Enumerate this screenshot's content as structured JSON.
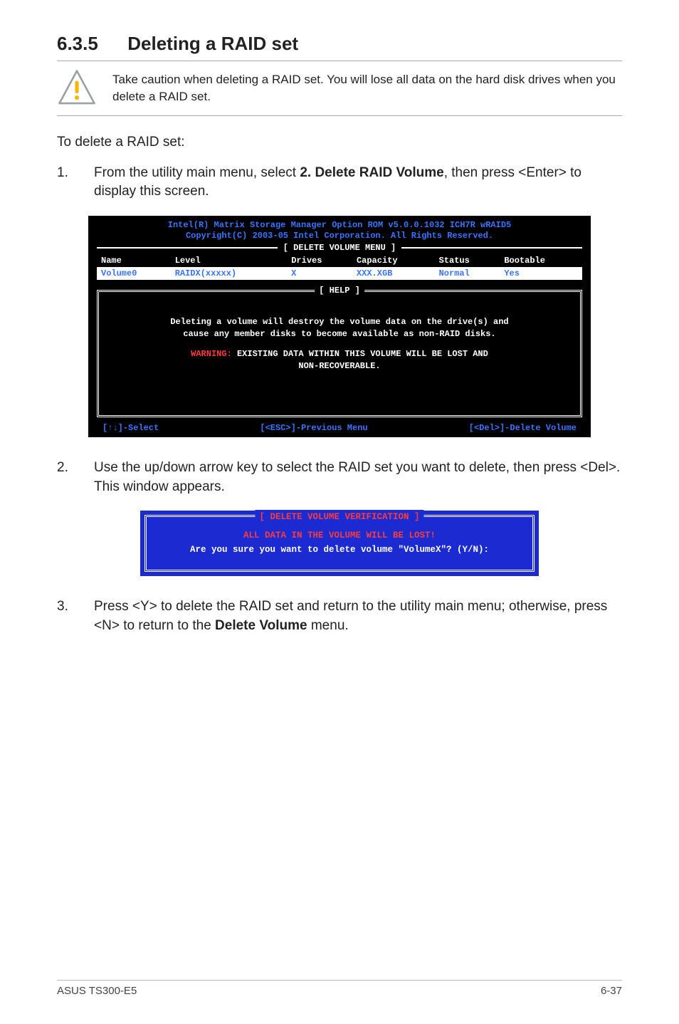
{
  "heading": {
    "number": "6.3.5",
    "title": "Deleting a RAID set"
  },
  "caution": {
    "text": "Take caution when deleting a RAID set. You will lose all data on the hard disk drives when you delete a RAID set."
  },
  "lead_text": "To delete a RAID set:",
  "steps": {
    "s1": {
      "num": "1.",
      "pre": "From the utility main menu, select ",
      "bold": "2. Delete RAID Volume",
      "post": ", then press <Enter> to display this screen."
    },
    "s2": {
      "num": "2.",
      "text": "Use the up/down arrow key to select the RAID set you want to delete, then press <Del>. This window appears."
    },
    "s3": {
      "num": "3.",
      "pre": "Press <Y> to delete the RAID set and return to the utility main menu; otherwise, press <N> to return to the ",
      "bold": "Delete Volume",
      "post": " menu."
    }
  },
  "bios1": {
    "header1": "Intel(R) Matrix Storage Manager Option ROM v5.0.0.1032 ICH7R wRAID5",
    "header2": "Copyright(C) 2003-05 Intel Corporation. All Rights Reserved.",
    "section_title": "[ DELETE VOLUME MENU ]",
    "cols": {
      "c1": "Name",
      "c2": "Level",
      "c3": "Drives",
      "c4": "Capacity",
      "c5": "Status",
      "c6": "Bootable"
    },
    "row": {
      "c1": "Volume0",
      "c2": "RAIDX(xxxxx)",
      "c3": "X",
      "c4": "XXX.XGB",
      "c5": "Normal",
      "c6": "Yes"
    },
    "help_title": "[ HELP ]",
    "help1": "Deleting a volume will destroy the volume data on the drive(s) and",
    "help2": "cause any member disks to become available as non-RAID disks.",
    "warn_label": "WARNING:",
    "warn_rest": " EXISTING DATA WITHIN THIS VOLUME WILL BE LOST AND",
    "warn_line2": "NON-RECOVERABLE.",
    "footer_left": "[↑↓]-Select",
    "footer_mid": "[<ESC>]-Previous Menu",
    "footer_right": "[<Del>]-Delete Volume"
  },
  "bios_dialog": {
    "title": "[ DELETE VOLUME VERIFICATION ]",
    "warn": "ALL DATA IN THE VOLUME WILL BE LOST!",
    "prompt": "Are you sure you want to delete volume \"VolumeX\"? (Y/N):"
  },
  "footer": {
    "left": "ASUS TS300-E5",
    "right": "6-37"
  }
}
